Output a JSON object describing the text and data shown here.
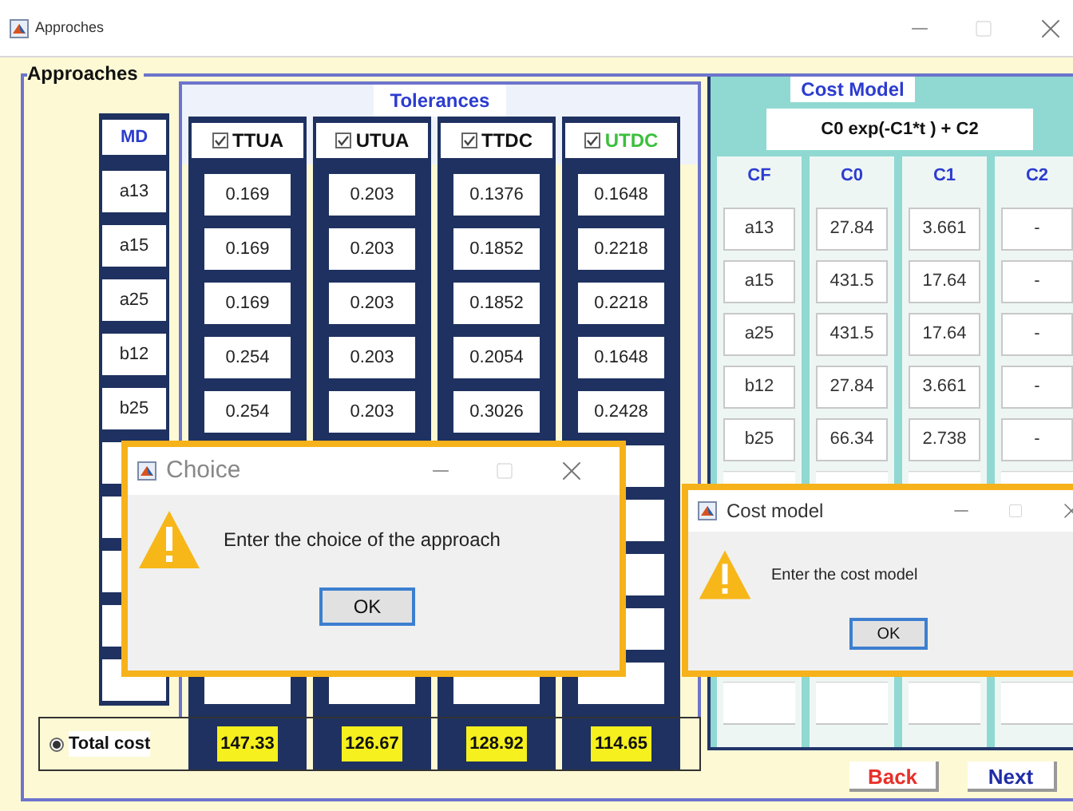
{
  "window": {
    "title": "Approches"
  },
  "group": {
    "title": "Approaches"
  },
  "tolerances": {
    "title": "Tolerances",
    "md_header": "MD",
    "columns": [
      {
        "label": "TTUA",
        "checked": true,
        "highlight": false
      },
      {
        "label": "UTUA",
        "checked": true,
        "highlight": false
      },
      {
        "label": "TTDC",
        "checked": true,
        "highlight": false
      },
      {
        "label": "UTDC",
        "checked": true,
        "highlight": true
      }
    ],
    "rows": [
      {
        "md": "a13",
        "values": [
          "0.169",
          "0.203",
          "0.1376",
          "0.1648"
        ]
      },
      {
        "md": "a15",
        "values": [
          "0.169",
          "0.203",
          "0.1852",
          "0.2218"
        ]
      },
      {
        "md": "a25",
        "values": [
          "0.169",
          "0.203",
          "0.1852",
          "0.2218"
        ]
      },
      {
        "md": "b12",
        "values": [
          "0.254",
          "0.203",
          "0.2054",
          "0.1648"
        ]
      },
      {
        "md": "b25",
        "values": [
          "0.254",
          "0.203",
          "0.3026",
          "0.2428"
        ]
      }
    ]
  },
  "total_cost": {
    "label": "Total cost",
    "selected": true,
    "values": [
      "147.33",
      "126.67",
      "128.92",
      "114.65"
    ]
  },
  "cost_model": {
    "title": "Cost Model",
    "formula": "C0 exp(-C1*t ) + C2",
    "columns": [
      "CF",
      "C0",
      "C1",
      "C2"
    ],
    "rows": [
      [
        "a13",
        "27.84",
        "3.661",
        "-"
      ],
      [
        "a15",
        "431.5",
        "17.64",
        "-"
      ],
      [
        "a25",
        "431.5",
        "17.64",
        "-"
      ],
      [
        "b12",
        "27.84",
        "3.661",
        "-"
      ],
      [
        "b25",
        "66.34",
        "2.738",
        "-"
      ]
    ]
  },
  "buttons": [
    {
      "label": "Back",
      "kind": "back"
    },
    {
      "label": "Next",
      "kind": "next"
    }
  ],
  "dialogs": [
    {
      "title": "Choice",
      "message": "Enter the choice of the approach",
      "button": "OK",
      "kind": "choice"
    },
    {
      "title": "Cost model",
      "message": "Enter the cost model",
      "button": "OK",
      "kind": "cost"
    }
  ]
}
